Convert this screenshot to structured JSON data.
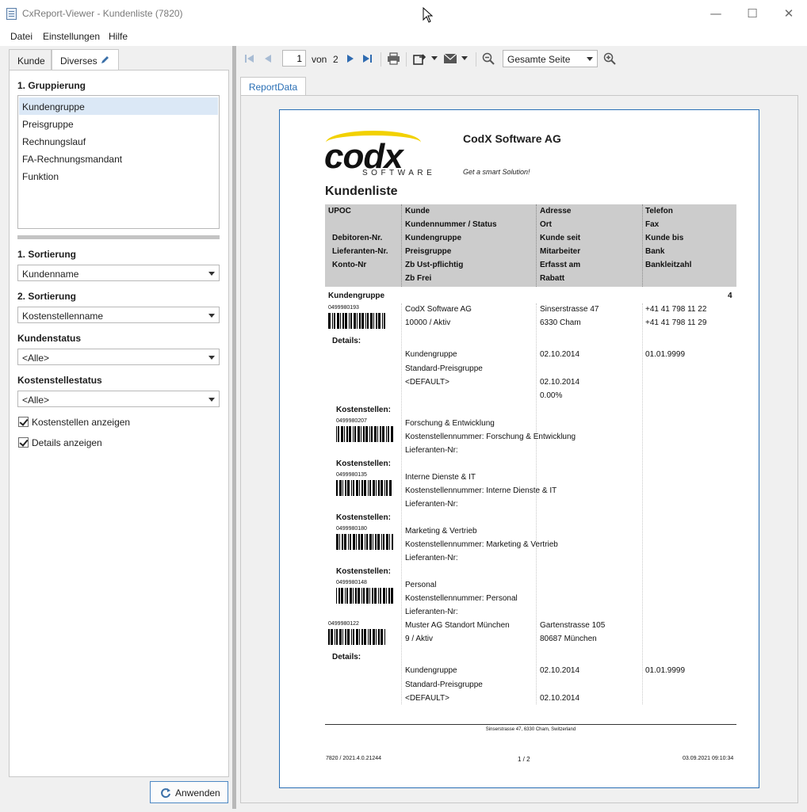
{
  "window": {
    "title": "CxReport-Viewer - Kundenliste (7820)",
    "controls": {
      "minimize": "—",
      "maximize": "☐",
      "close": "✕"
    }
  },
  "menu": [
    "Datei",
    "Einstellungen",
    "Hilfe"
  ],
  "left_tabs": {
    "kunde": "Kunde",
    "diverses": "Diverses"
  },
  "grouping": {
    "title": "1. Gruppierung",
    "items": [
      "Kundengruppe",
      "Preisgruppe",
      "Rechnungslauf",
      "FA-Rechnungsmandant",
      "Funktion"
    ],
    "selected": "Kundengruppe"
  },
  "sort1": {
    "label": "1. Sortierung",
    "value": "Kundenname"
  },
  "sort2": {
    "label": "2. Sortierung",
    "value": "Kostenstellenname"
  },
  "kundenstatus": {
    "label": "Kundenstatus",
    "value": "<Alle>"
  },
  "kostenstellestatus": {
    "label": "Kostenstellestatus",
    "value": "<Alle>"
  },
  "checkboxes": {
    "kostenstellen": "Kostenstellen anzeigen",
    "details": "Details anzeigen"
  },
  "apply_label": "Anwenden",
  "toolbar": {
    "page": "1",
    "of_label": "von",
    "total_pages": "2",
    "zoom": "Gesamte Seite"
  },
  "report_tab": "ReportData",
  "report": {
    "logo_main": "codx",
    "logo_sub": "SOFTWARE",
    "company": "CodX Software AG",
    "slogan": "Get a smart Solution!",
    "title": "Kundenliste",
    "header": {
      "col1": [
        "UPOC",
        "",
        "Debitoren-Nr.",
        "Lieferanten-Nr.",
        "Konto-Nr",
        ""
      ],
      "col2": [
        "Kunde",
        "Kundennummer / Status",
        "Kundengruppe",
        "Preisgruppe",
        "Zb Ust-pflichtig",
        "Zb Frei"
      ],
      "col3": [
        "Adresse",
        "Ort",
        "Kunde seit",
        "Mitarbeiter",
        "Erfasst am",
        "Rabatt"
      ],
      "col4": [
        "Telefon",
        "Fax",
        "Kunde bis",
        "Bank",
        "Bankleitzahl",
        ""
      ]
    },
    "group_label": "Kundengruppe",
    "group_count": "4",
    "customer1": {
      "code": "0499980193",
      "name": "CodX Software AG",
      "number_status": "10000 / Aktiv",
      "street": "Sinserstrasse 47",
      "city": "6330 Cham",
      "phone": "+41 41 798 11 22",
      "fax": "+41 41 798 11 29",
      "details_label": "Details:",
      "details_col2": [
        "Kundengruppe",
        "Standard-Preisgruppe",
        "<DEFAULT>"
      ],
      "details_col3": [
        "02.10.2014",
        "",
        "02.10.2014",
        "0.00%"
      ],
      "details_col4": "01.01.9999"
    },
    "cost_centers": [
      {
        "label": "Kostenstellen:",
        "code": "0499980207",
        "name": "Forschung & Entwicklung",
        "number": "Kostenstellennummer: Forschung & Entwicklung",
        "supplier": "Lieferanten-Nr:"
      },
      {
        "label": "Kostenstellen:",
        "code": "0499980135",
        "name": "Interne Dienste & IT",
        "number": "Kostenstellennummer: Interne Dienste & IT",
        "supplier": "Lieferanten-Nr:"
      },
      {
        "label": "Kostenstellen:",
        "code": "0499980180",
        "name": "Marketing & Vertrieb",
        "number": "Kostenstellennummer: Marketing & Vertrieb",
        "supplier": "Lieferanten-Nr:"
      },
      {
        "label": "Kostenstellen:",
        "code": "0499980148",
        "name": "Personal",
        "number": "Kostenstellennummer: Personal",
        "supplier": "Lieferanten-Nr:"
      }
    ],
    "customer2": {
      "code": "0499980122",
      "name": "Muster AG Standort München",
      "number_status": "9 / Aktiv",
      "street": "Gartenstrasse 105",
      "city": "80687 München",
      "details_label": "Details:",
      "details_col2": [
        "Kundengruppe",
        "Standard-Preisgruppe",
        "<DEFAULT>"
      ],
      "details_col3": [
        "02.10.2014",
        "",
        "02.10.2014"
      ],
      "details_col4": "01.01.9999"
    },
    "footer_address": "Sinserstrasse 47, 6330 Cham, Switzerland",
    "footer_left": "7820 / 2021.4.0.21244",
    "footer_center": "1 / 2",
    "footer_right": "03.09.2021 09:10:34"
  }
}
